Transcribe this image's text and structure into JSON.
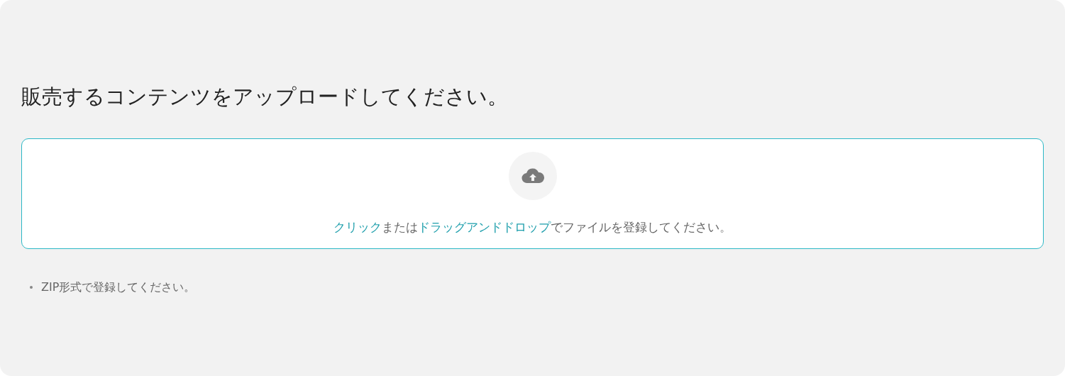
{
  "heading": "販売するコンテンツをアップロードしてください。",
  "dropzone": {
    "instruction": [
      {
        "kind": "link",
        "text": "クリック"
      },
      {
        "kind": "text",
        "text": "または"
      },
      {
        "kind": "link",
        "text": "ドラッグアンドドロップ"
      },
      {
        "kind": "text",
        "text": "でファイルを登録してください。"
      }
    ]
  },
  "notes": [
    "ZIP形式で登録してください。"
  ]
}
